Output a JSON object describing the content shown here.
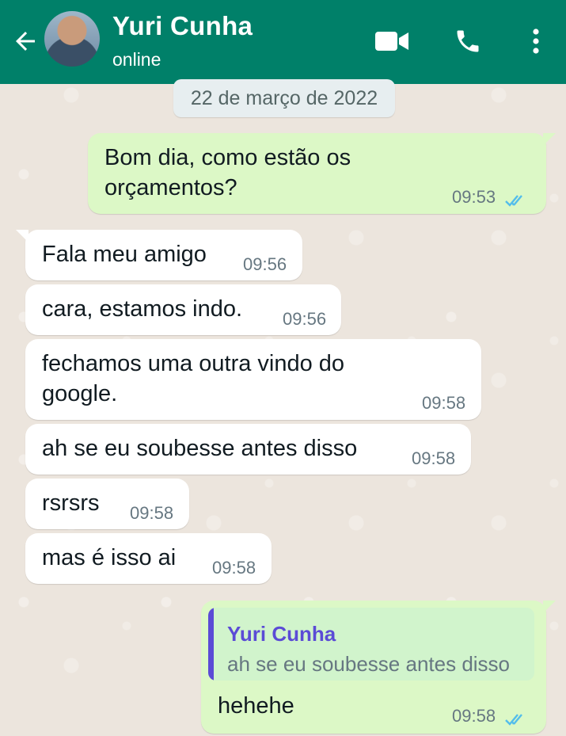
{
  "header": {
    "contact_name": "Yuri Cunha",
    "status": "online",
    "color": "#008069"
  },
  "date_chip": "22 de março de 2022",
  "messages": [
    {
      "direction": "out",
      "text": "Bom dia, como estão os\norçamentos?",
      "time": "09:53",
      "ticks": "read"
    },
    {
      "direction": "in",
      "text": "Fala meu amigo",
      "time": "09:56"
    },
    {
      "direction": "in",
      "text": "cara, estamos indo.",
      "time": "09:56"
    },
    {
      "direction": "in",
      "text": "fechamos uma outra vindo do\ngoogle.",
      "time": "09:58"
    },
    {
      "direction": "in",
      "text": "ah se eu soubesse antes disso",
      "time": "09:58"
    },
    {
      "direction": "in",
      "text": "rsrsrs",
      "time": "09:58"
    },
    {
      "direction": "in",
      "text": "mas é isso ai",
      "time": "09:58"
    },
    {
      "direction": "out",
      "text": "hehehe",
      "time": "09:58",
      "ticks": "read",
      "reply": {
        "author": "Yuri Cunha",
        "text": "ah se eu soubesse antes disso"
      }
    }
  ],
  "icons": {
    "back": "back-arrow-icon",
    "video": "video-call-icon",
    "phone": "phone-icon",
    "menu": "more-vert-icon",
    "read": "double-check-icon"
  },
  "colors": {
    "chat_bg": "#ece5dd",
    "bubble_out": "#dcf8c6",
    "bubble_in": "#ffffff",
    "read_ticks": "#53bdeb",
    "quote_accent": "#5b4bd6"
  }
}
